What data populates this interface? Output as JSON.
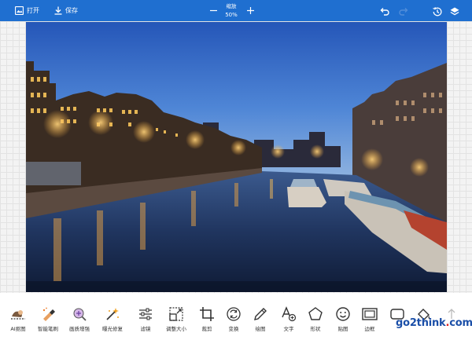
{
  "toolbar": {
    "open_label": "打开",
    "save_label": "保存",
    "zoom_label": "缩放",
    "zoom_value": "50%"
  },
  "tools": [
    {
      "label": "AI抠图",
      "icon": "ai-cutout-icon"
    },
    {
      "label": "智能笔刷",
      "icon": "smart-brush-icon"
    },
    {
      "label": "画质增强",
      "icon": "quality-enhance-icon"
    },
    {
      "label": "曝光修复",
      "icon": "exposure-fix-icon"
    },
    {
      "label": "滤镜",
      "icon": "filter-sliders-icon"
    },
    {
      "label": "调整大小",
      "icon": "resize-icon"
    },
    {
      "label": "裁剪",
      "icon": "crop-icon"
    },
    {
      "label": "变换",
      "icon": "transform-icon"
    },
    {
      "label": "绘图",
      "icon": "pencil-icon"
    },
    {
      "label": "文字",
      "icon": "text-icon"
    },
    {
      "label": "形状",
      "icon": "shape-pentagon-icon"
    },
    {
      "label": "贴图",
      "icon": "sticker-smiley-icon"
    },
    {
      "label": "边框",
      "icon": "border-frame-icon"
    },
    {
      "label": "",
      "icon": "rounded-rect-icon"
    },
    {
      "label": "",
      "icon": "fill-bucket-icon"
    },
    {
      "label": "",
      "icon": "upload-arrow-icon"
    }
  ],
  "watermark": {
    "main": "go2think",
    "dot": ".",
    "tld": "com"
  },
  "colors": {
    "toolbar_bg": "#1f6fd0",
    "canvas_bg": "#f3f3f3"
  }
}
